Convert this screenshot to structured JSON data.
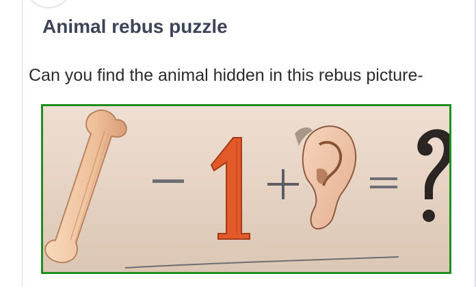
{
  "post": {
    "title": "Animal rebus puzzle",
    "question": "Can you find the animal hidden in this rebus picture-"
  },
  "rebus": {
    "digit": "1",
    "equals_symbol": "=",
    "question_mark": "?",
    "icons": [
      "bone-icon",
      "minus-icon",
      "number-one",
      "plus-icon",
      "ear-icon",
      "equals-icon",
      "question-mark-icon"
    ],
    "colors": {
      "frame_border": "#1e8f1e",
      "paper": "#e5d3c5",
      "bone": "#f2c9a3",
      "digit_one": "#e2592a",
      "ear": "#f0c6a8"
    }
  }
}
